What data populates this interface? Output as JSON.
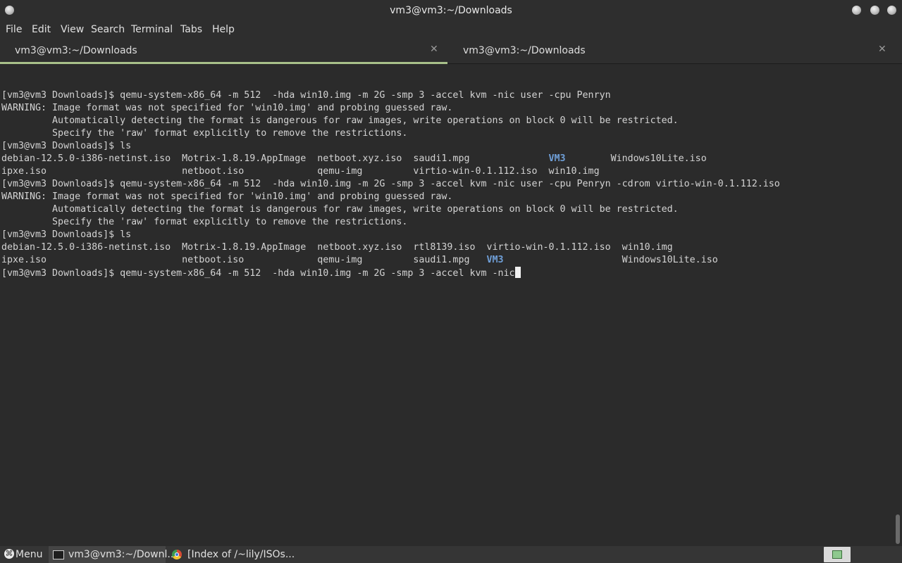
{
  "window": {
    "title": "vm3@vm3:~/Downloads"
  },
  "menu": [
    "File",
    "Edit",
    "View",
    "Search",
    "Terminal",
    "Tabs",
    "Help"
  ],
  "tabs": [
    {
      "label": "vm3@vm3:~/Downloads",
      "close": "✕",
      "active": true
    },
    {
      "label": "vm3@vm3:~/Downloads",
      "close": "✕",
      "active": false
    }
  ],
  "terminal": {
    "lines": [
      [
        {
          "t": "[vm3@vm3 Downloads]$ qemu-system-x86_64 -m 512  -hda win10.img -m 2G -smp 3 -accel kvm -nic user -cpu Penryn"
        }
      ],
      [
        {
          "t": "WARNING: Image format was not specified for 'win10.img' and probing guessed raw."
        }
      ],
      [
        {
          "t": "         Automatically detecting the format is dangerous for raw images, write operations on block 0 will be restricted."
        }
      ],
      [
        {
          "t": "         Specify the 'raw' format explicitly to remove the restrictions."
        }
      ],
      [
        {
          "t": "[vm3@vm3 Downloads]$ ls"
        }
      ],
      [
        {
          "t": "debian-12.5.0-i386-netinst.iso  Motrix-1.8.19.AppImage  netboot.xyz.iso  saudi1.mpg              "
        },
        {
          "t": "VM3",
          "dir": true
        },
        {
          "t": "        Windows10Lite.iso"
        }
      ],
      [
        {
          "t": "ipxe.iso                        netboot.iso             qemu-img         virtio-win-0.1.112.iso  win10.img"
        }
      ],
      [
        {
          "t": "[vm3@vm3 Downloads]$ qemu-system-x86_64 -m 512  -hda win10.img -m 2G -smp 3 -accel kvm -nic user -cpu Penryn -cdrom virtio-win-0.1.112.iso"
        }
      ],
      [
        {
          "t": "WARNING: Image format was not specified for 'win10.img' and probing guessed raw."
        }
      ],
      [
        {
          "t": "         Automatically detecting the format is dangerous for raw images, write operations on block 0 will be restricted."
        }
      ],
      [
        {
          "t": "         Specify the 'raw' format explicitly to remove the restrictions."
        }
      ],
      [
        {
          "t": "[vm3@vm3 Downloads]$ ls"
        }
      ],
      [
        {
          "t": "debian-12.5.0-i386-netinst.iso  Motrix-1.8.19.AppImage  netboot.xyz.iso  rtl8139.iso  virtio-win-0.1.112.iso  win10.img"
        }
      ],
      [
        {
          "t": "ipxe.iso                        netboot.iso             qemu-img         saudi1.mpg   "
        },
        {
          "t": "VM3",
          "dir": true
        },
        {
          "t": "                     Windows10Lite.iso"
        }
      ]
    ],
    "prompt_line": "[vm3@vm3 Downloads]$ qemu-system-x86_64 -m 512  -hda win10.img -m 2G -smp 3 -accel kvm -nic"
  },
  "taskbar": {
    "menu_label": "Menu",
    "items": [
      {
        "label": "vm3@vm3:~/Downl...",
        "icon": "terminal-icon"
      },
      {
        "label": "[Index of /~lily/ISOs...",
        "icon": "chromium-icon"
      }
    ]
  }
}
